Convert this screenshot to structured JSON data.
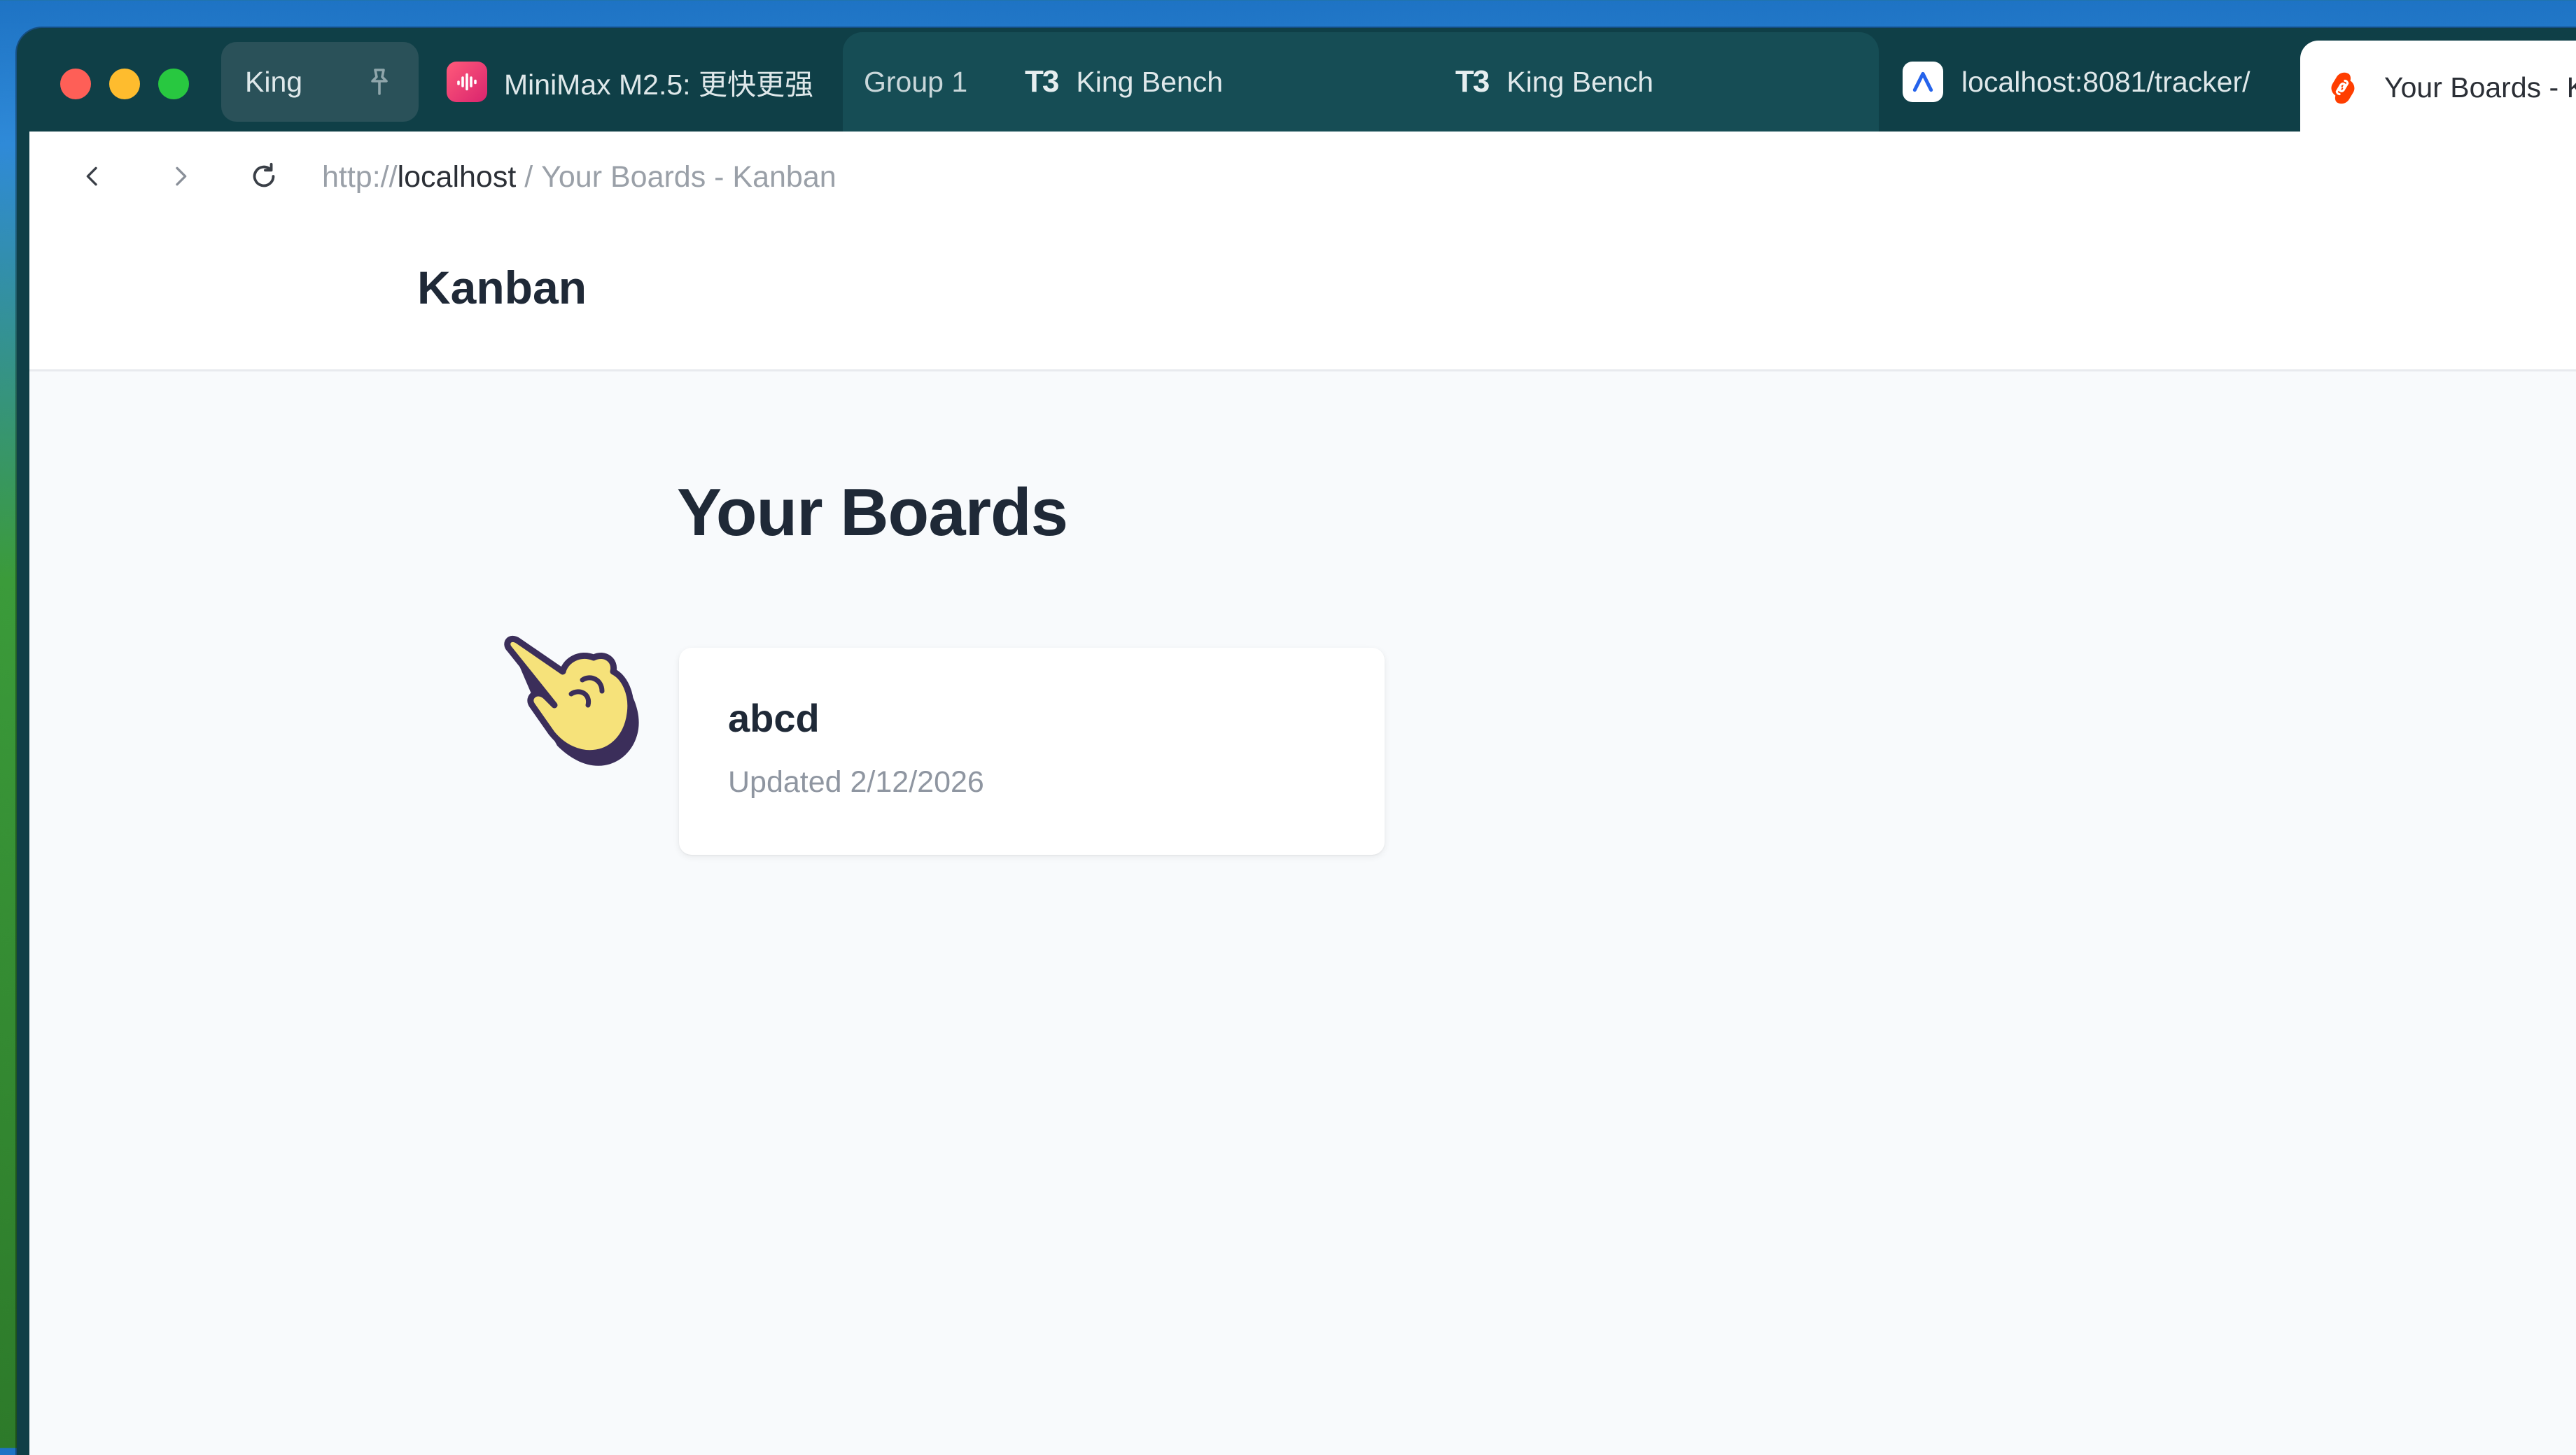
{
  "browser": {
    "tabs": {
      "king": "King",
      "minimax": "MiniMax M2.5: 更快更强",
      "group_label": "Group 1",
      "king_bench_1": "King Bench",
      "king_bench_2": "King Bench",
      "localhost_tracker": "localhost:8081/tracker/",
      "active": "Your Boards - K"
    },
    "url": {
      "scheme": "http://",
      "host": "localhost",
      "separator": " / ",
      "page": "Your Boards - Kanban"
    }
  },
  "app": {
    "brand": "Kanban",
    "page_title": "Your Boards",
    "boards": [
      {
        "name": "abcd",
        "updated": "Updated 2/12/2026"
      }
    ]
  },
  "colors": {
    "tabbar": "#0f3f47",
    "group_bg": "#164d55",
    "page_bg": "#f8fafc",
    "heading": "#1f2937",
    "muted": "#8f96a1"
  }
}
